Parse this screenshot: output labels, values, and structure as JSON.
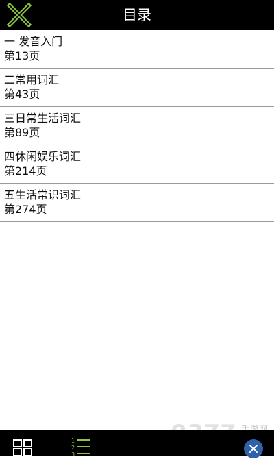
{
  "header": {
    "title": "目录",
    "close_icon": "close-x-icon",
    "accent_color": "#8dc63f"
  },
  "toc": {
    "items": [
      {
        "title": "一 发音入门",
        "page": "第13页"
      },
      {
        "title": "二常用词汇",
        "page": "第43页"
      },
      {
        "title": "三日常生活词汇",
        "page": "第89页"
      },
      {
        "title": "四休闲娱乐词汇",
        "page": "第214页"
      },
      {
        "title": "五生活常识词汇",
        "page": "第274页"
      }
    ]
  },
  "bottom_bar": {
    "grid_icon": "grid-view-icon",
    "list_icon": "numbered-list-icon"
  },
  "watermark": {
    "text": "手游网"
  }
}
